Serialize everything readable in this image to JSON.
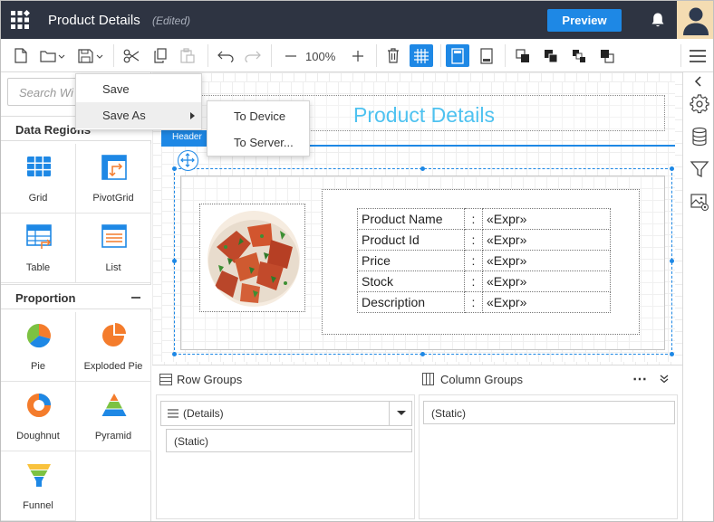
{
  "header": {
    "title": "Product Details",
    "status": "(Edited)",
    "preview_label": "Preview"
  },
  "toolbar": {
    "zoom": "100%"
  },
  "save_menu": {
    "save": "Save",
    "save_as": "Save As",
    "submenu": {
      "to_device": "To Device",
      "to_server": "To Server..."
    }
  },
  "left_panel": {
    "search_placeholder": "Search Wi",
    "data_regions": {
      "title": "Data Regions",
      "items": [
        {
          "label": "Grid",
          "icon": "grid-icon"
        },
        {
          "label": "PivotGrid",
          "icon": "pivotgrid-icon"
        },
        {
          "label": "Table",
          "icon": "table-icon"
        },
        {
          "label": "List",
          "icon": "list-icon"
        }
      ]
    },
    "proportion": {
      "title": "Proportion",
      "items": [
        {
          "label": "Pie",
          "icon": "pie-icon"
        },
        {
          "label": "Exploded Pie",
          "icon": "exploded-pie-icon"
        },
        {
          "label": "Doughnut",
          "icon": "doughnut-icon"
        },
        {
          "label": "Pyramid",
          "icon": "pyramid-icon"
        },
        {
          "label": "Funnel",
          "icon": "funnel-icon"
        }
      ]
    }
  },
  "report": {
    "title": "Product Details",
    "header_tag": "Header",
    "rows": [
      {
        "label": "Product Name",
        "sep": ":",
        "value": "«Expr»"
      },
      {
        "label": "Product Id",
        "sep": ":",
        "value": "«Expr»"
      },
      {
        "label": "Price",
        "sep": ":",
        "value": "«Expr»"
      },
      {
        "label": "Stock",
        "sep": ":",
        "value": "«Expr»"
      },
      {
        "label": "Description",
        "sep": ":",
        "value": "«Expr»"
      }
    ]
  },
  "groups": {
    "row_groups_title": "Row Groups",
    "column_groups_title": "Column Groups",
    "row_items": [
      "(Details)",
      "(Static)"
    ],
    "column_items": [
      "(Static)"
    ]
  },
  "colors": {
    "topbar": "#2e3442",
    "accent": "#1e88e5",
    "report_title": "#4ec2f0"
  }
}
